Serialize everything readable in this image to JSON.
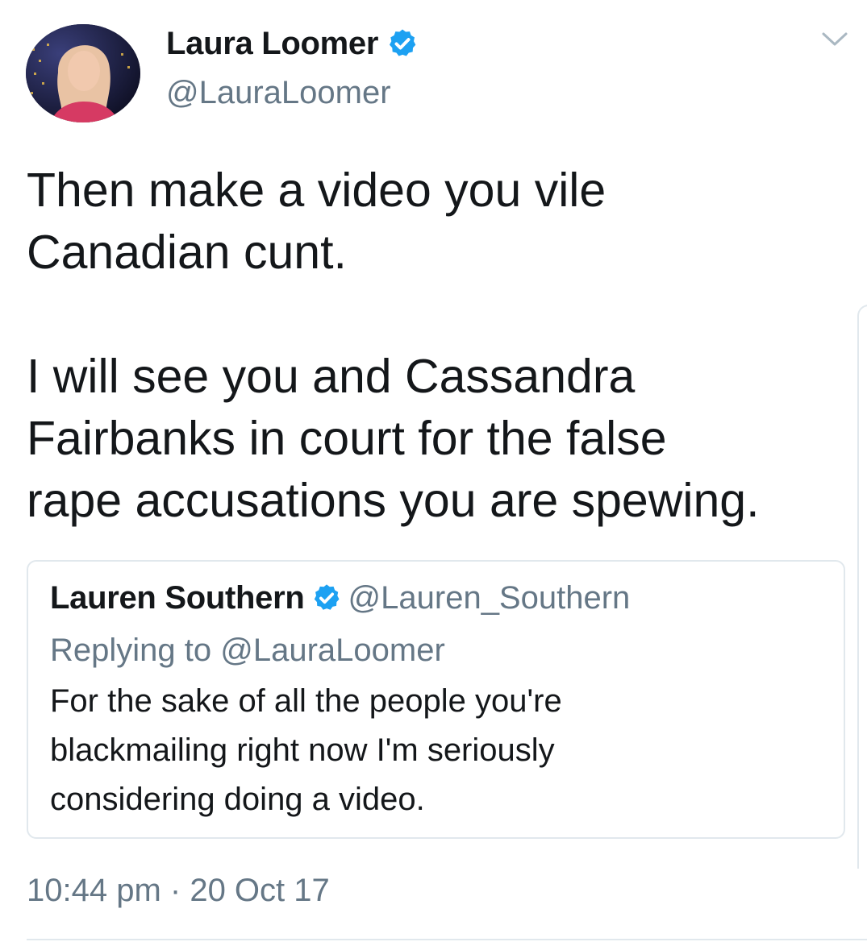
{
  "author": {
    "name": "Laura Loomer",
    "handle": "@LauraLoomer",
    "verified": true,
    "avatar_icon": "profile-photo"
  },
  "menu_icon": "chevron-down-icon",
  "tweet": {
    "lines": [
      "Then make a video you vile",
      "Canadian cunt.",
      "",
      "I will see you and Cassandra",
      "Fairbanks in court for the false",
      "rape accusations you are spewing."
    ]
  },
  "quoted_tweet": {
    "name": "Lauren Southern",
    "handle": "@Lauren_Southern",
    "verified": true,
    "replying_to": "Replying to @LauraLoomer",
    "lines": [
      "For the sake of all the people you're",
      "blackmailing right now I'm seriously",
      "considering doing a video."
    ]
  },
  "timestamp": "10:44 pm · 20 Oct 17",
  "colors": {
    "verified_blue": "#1da1f2",
    "secondary_text": "#657786",
    "primary_text": "#14171a",
    "border": "#e1e8ed"
  }
}
